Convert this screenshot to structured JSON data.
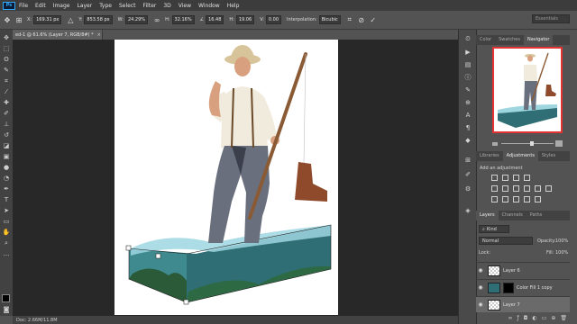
{
  "app": {
    "logo": "Ps"
  },
  "menu": [
    "File",
    "Edit",
    "Image",
    "Layer",
    "Type",
    "Select",
    "Filter",
    "3D",
    "View",
    "Window",
    "Help"
  ],
  "options": {
    "x_label": "X:",
    "x_value": "169.31 px",
    "y_label": "Y:",
    "y_value": "853.58 px",
    "w_label": "W:",
    "w_value": "24.29%",
    "h_label": "H:",
    "h_value": "32.16%",
    "angle_value": "16.48",
    "h2_label": "H:",
    "h2_value": "19.06",
    "v_label": "V:",
    "v_value": "0.00",
    "interp_label": "Interpolation:",
    "interp_value": "Bicubic",
    "workspace": "Essentials"
  },
  "document": {
    "tab_title": "ed-1 @ 61.6% (Layer 7, RGB/8#) *",
    "close": "×"
  },
  "status": {
    "text": "Doc: 2.66M/11.8M"
  },
  "top_panel": {
    "tabs": [
      "Color",
      "Swatches",
      "Navigator"
    ],
    "active": 2
  },
  "mid_panel": {
    "tabs": [
      "Libraries",
      "Adjustments",
      "Styles"
    ],
    "active": 1,
    "add_label": "Add an adjustment"
  },
  "layers_panel": {
    "tabs": [
      "Layers",
      "Channels",
      "Paths"
    ],
    "active": 0,
    "kind": "Kind",
    "blend": "Normal",
    "opacity_label": "Opacity:",
    "opacity_value": "100%",
    "lock_label": "Lock:",
    "fill_label": "Fill:",
    "fill_value": "100%",
    "layers": [
      {
        "name": "Layer 6",
        "thumb": "checker",
        "selected": false
      },
      {
        "name": "Color Fill 1 copy",
        "thumb": "teal",
        "selected": false
      },
      {
        "name": "Layer 7",
        "thumb": "checker",
        "selected": true
      }
    ]
  },
  "colors": {
    "selection": "#e53232",
    "accent": "#31a8ff",
    "selected_layer": "#6a6a6a"
  }
}
